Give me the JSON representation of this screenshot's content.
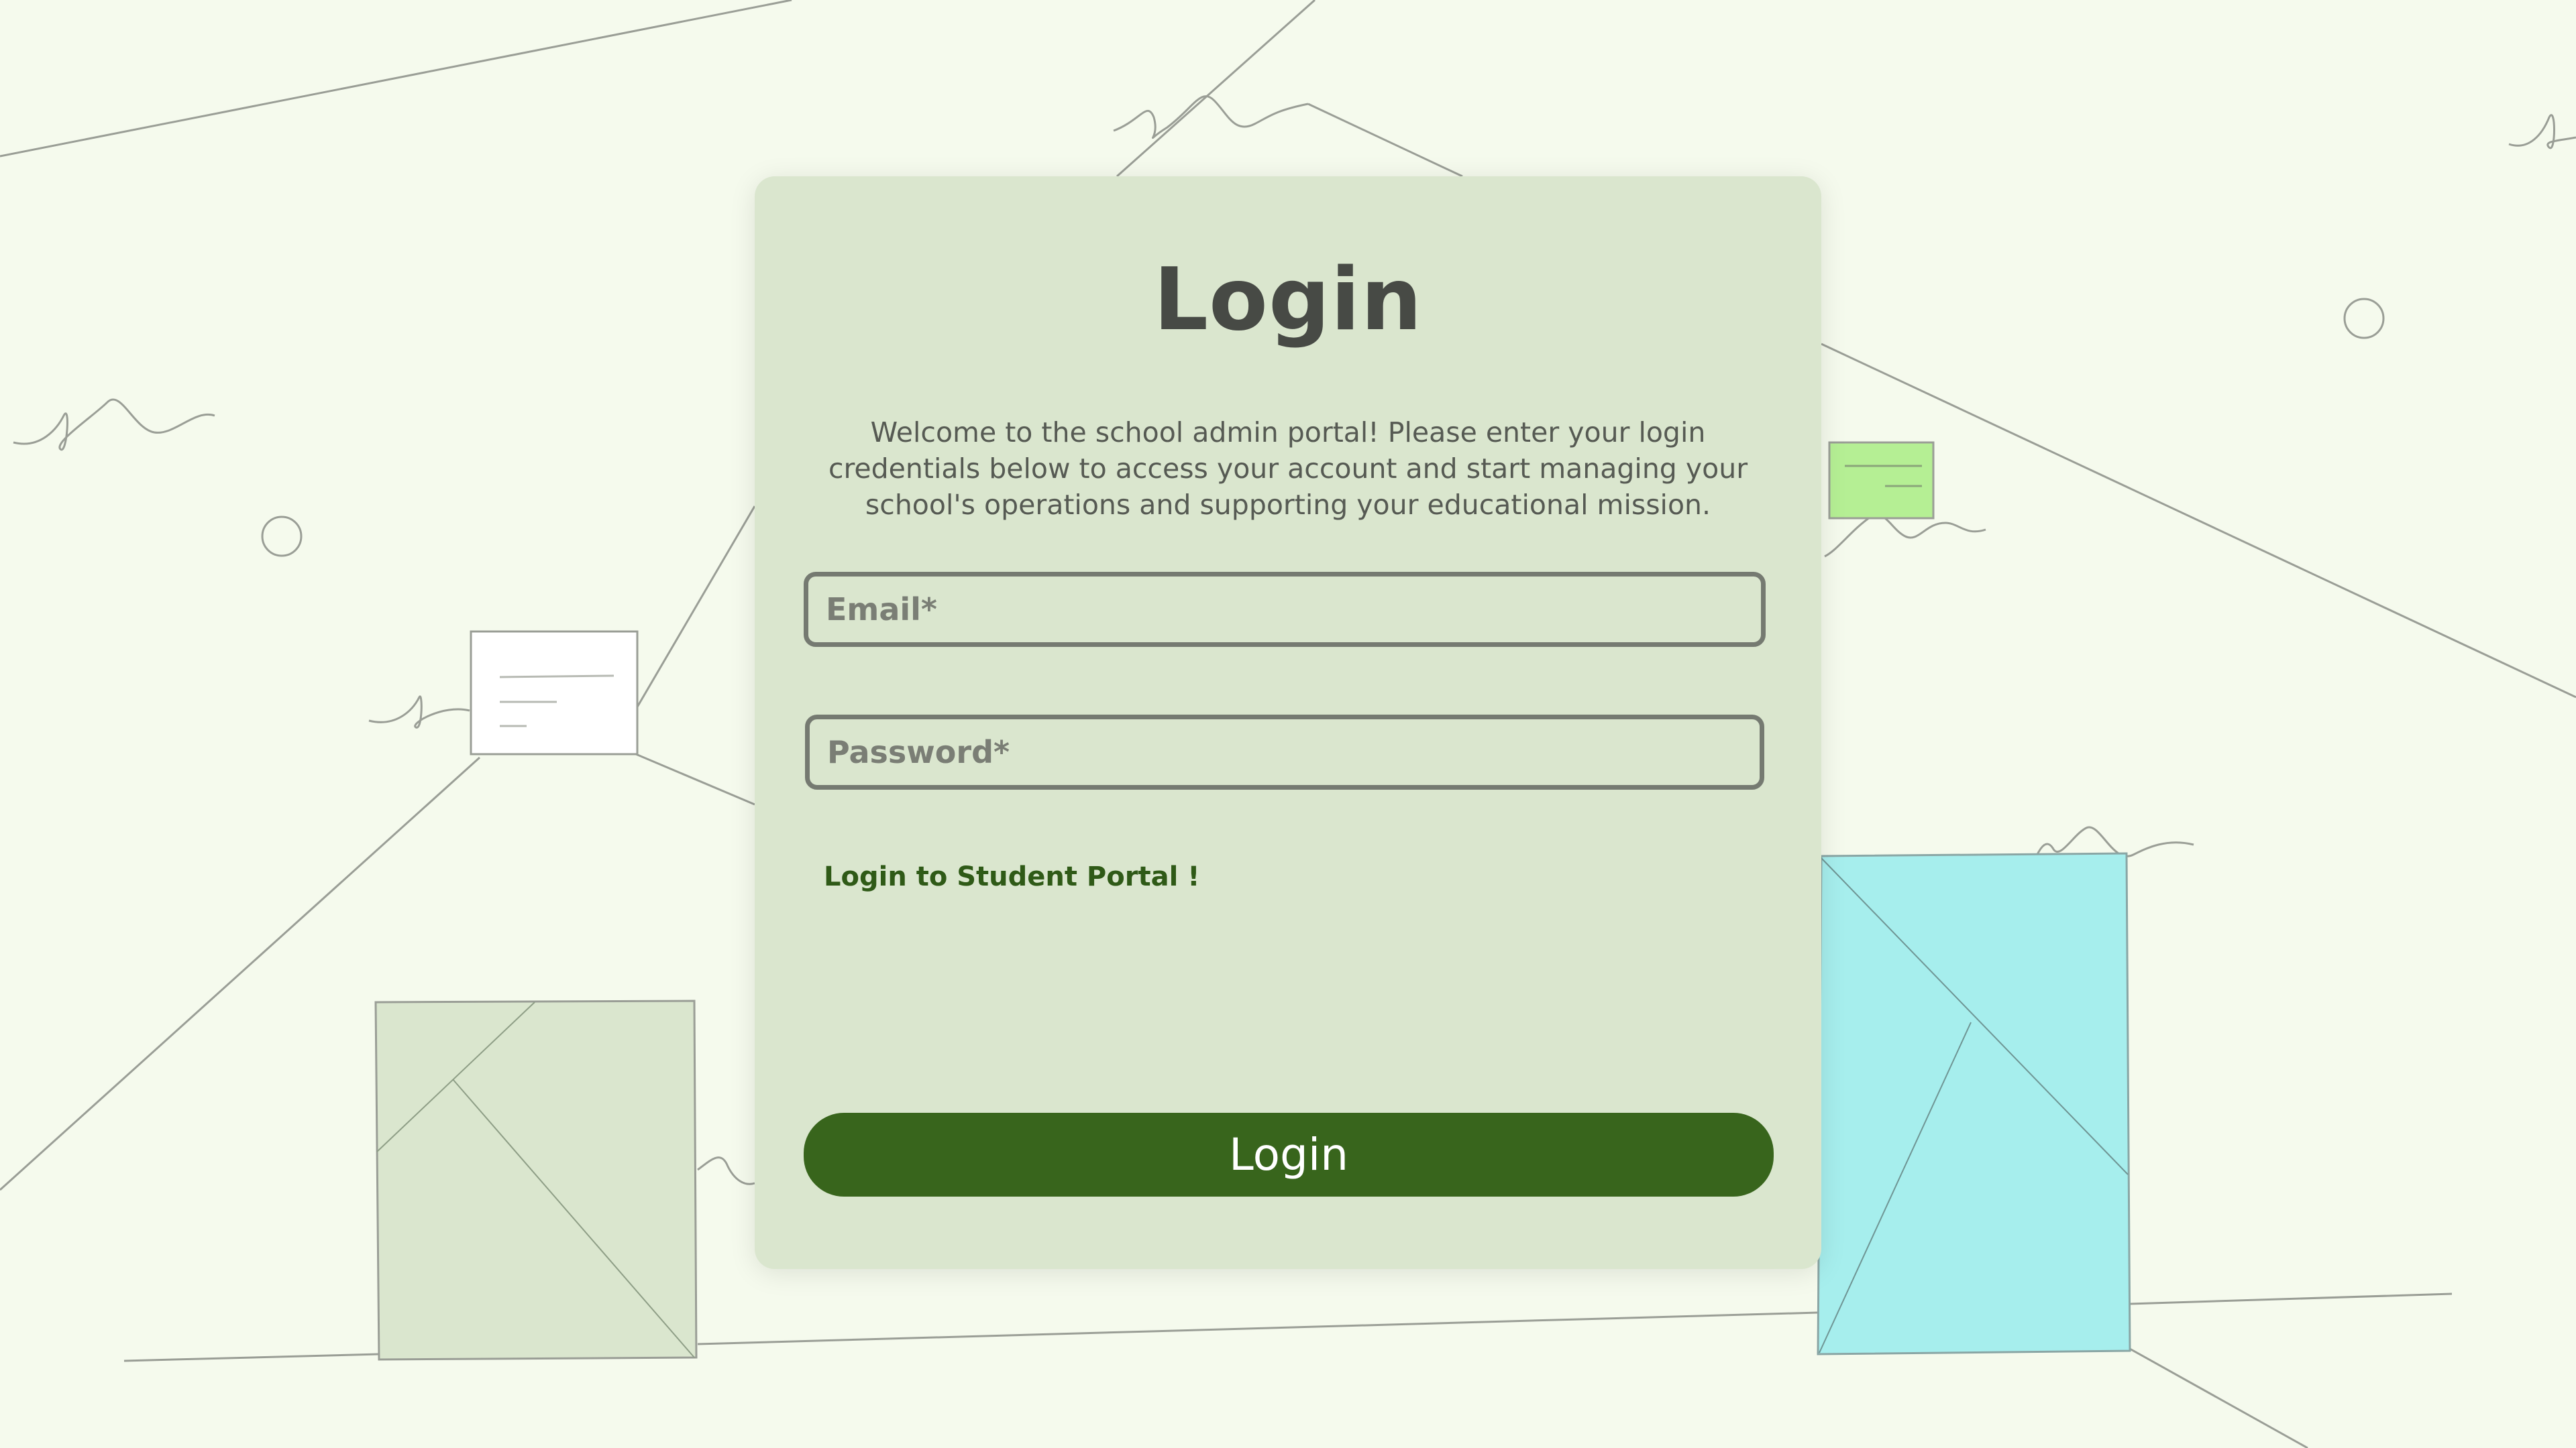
{
  "login": {
    "title": "Login",
    "welcome_text": "Welcome to the school admin portal! Please enter your login credentials below to access your account and start managing your school's operations and supporting your educational mission.",
    "email_placeholder": "Email*",
    "email_value": "",
    "password_placeholder": "Password*",
    "password_value": "",
    "student_portal_link": "Login to Student Portal !",
    "submit_label": "Login"
  },
  "colors": {
    "page_background": "#f5faed",
    "card_background": "#dae6ce",
    "title_text": "#474a45",
    "field_border": "#757a71",
    "link_text": "#2f5a17",
    "button_background": "#38651c",
    "button_text": "#ffffff",
    "decor_green_box": "#dae6ce",
    "decor_cyan_box": "#a6eeed",
    "decor_lime_note": "#b5ef94",
    "decor_white_note": "#ffffff"
  },
  "decorations": {
    "icons": [
      "background-line-art",
      "paper-note-icon",
      "sticky-note-icon",
      "circle-ornament",
      "squiggle-ornament",
      "folded-box-illustration"
    ]
  }
}
